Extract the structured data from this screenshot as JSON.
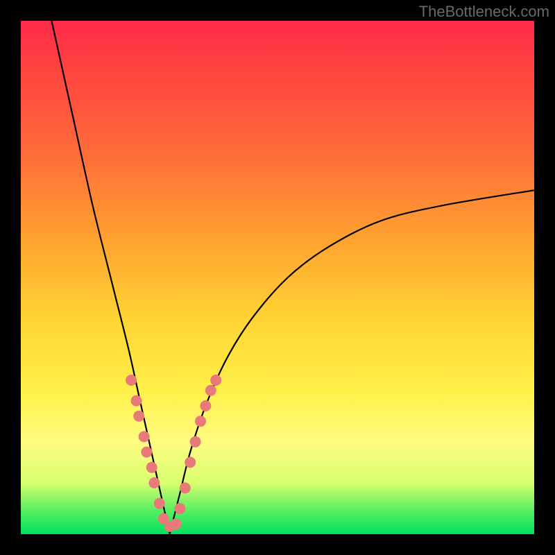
{
  "watermark": "TheBottleneck.com",
  "colors": {
    "frame": "#000000",
    "curve": "#000000",
    "marker_fill": "#e97a7a",
    "marker_stroke": "#d65a5a",
    "gradient": [
      "#ff2a4a",
      "#ff6a3a",
      "#ffd433",
      "#fffc80",
      "#00e060"
    ]
  },
  "chart_data": {
    "type": "line",
    "title": "",
    "xlabel": "",
    "ylabel": "",
    "xlim": [
      0,
      100
    ],
    "ylim": [
      0,
      100
    ],
    "grid": false,
    "legend": false,
    "notes": "V-shaped bottleneck curve; x ≈ component ratio, y ≈ bottleneck %. Minimum near x≈29, y≈0. Left branch starts near (6,100); right branch ends near (100,67). Pink markers cluster on both branches roughly where y is between 2 and 30.",
    "series": [
      {
        "name": "curve",
        "x": [
          6,
          10,
          14,
          18,
          21,
          23,
          25,
          27,
          29,
          31,
          33,
          36,
          40,
          45,
          52,
          60,
          70,
          82,
          100
        ],
        "y": [
          100,
          82,
          64,
          48,
          36,
          27,
          18,
          9,
          0,
          8,
          16,
          25,
          34,
          42,
          50,
          56,
          61,
          64,
          67
        ]
      }
    ],
    "markers": {
      "name": "highlight-points",
      "type": "scatter",
      "color": "#e97a7a",
      "points": [
        {
          "x": 21.5,
          "y": 30
        },
        {
          "x": 22.5,
          "y": 26
        },
        {
          "x": 23.0,
          "y": 23
        },
        {
          "x": 24.0,
          "y": 19
        },
        {
          "x": 24.5,
          "y": 16
        },
        {
          "x": 25.5,
          "y": 13
        },
        {
          "x": 26.0,
          "y": 10
        },
        {
          "x": 27.0,
          "y": 6
        },
        {
          "x": 27.8,
          "y": 3
        },
        {
          "x": 29.0,
          "y": 1.5
        },
        {
          "x": 30.2,
          "y": 2
        },
        {
          "x": 31.0,
          "y": 5
        },
        {
          "x": 32.0,
          "y": 9
        },
        {
          "x": 33.0,
          "y": 14
        },
        {
          "x": 34.0,
          "y": 18
        },
        {
          "x": 35.0,
          "y": 22
        },
        {
          "x": 36.0,
          "y": 25
        },
        {
          "x": 37.0,
          "y": 28
        },
        {
          "x": 38.0,
          "y": 30
        }
      ]
    }
  }
}
